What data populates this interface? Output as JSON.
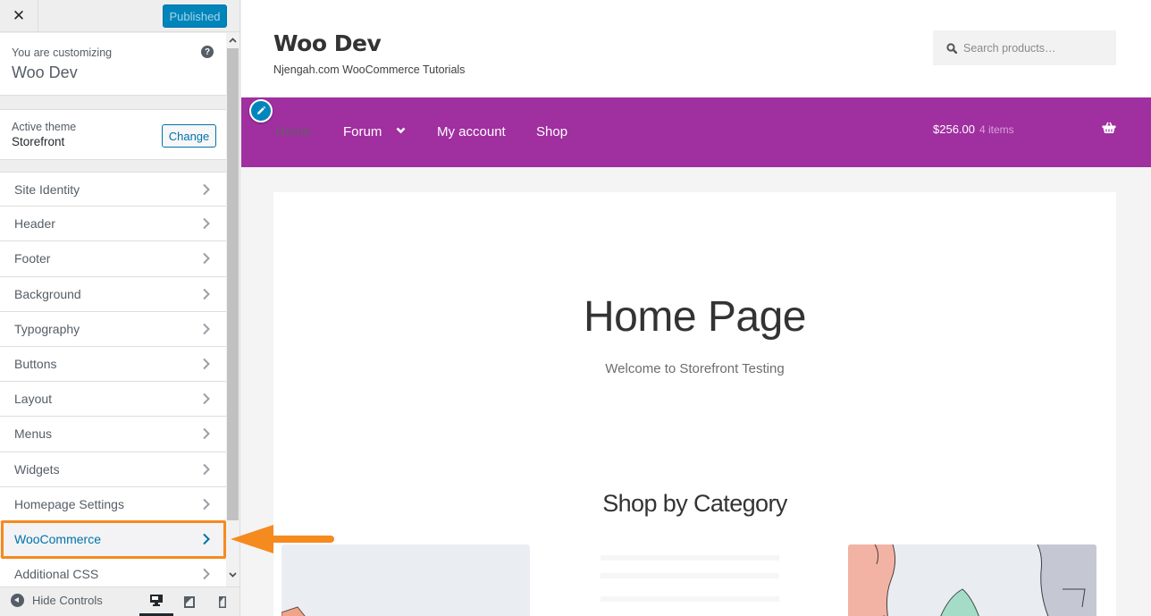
{
  "sidebar": {
    "close_label": "✕",
    "publish_button": "Published",
    "customizing_label": "You are customizing",
    "site_name": "Woo Dev",
    "help_icon": "?",
    "active_theme_label": "Active theme",
    "active_theme_name": "Storefront",
    "change_button": "Change",
    "sections": [
      {
        "label": "Site Identity"
      },
      {
        "label": "Header"
      },
      {
        "label": "Footer"
      },
      {
        "label": "Background"
      },
      {
        "label": "Typography"
      },
      {
        "label": "Buttons"
      },
      {
        "label": "Layout"
      },
      {
        "label": "Menus"
      },
      {
        "label": "Widgets"
      },
      {
        "label": "Homepage Settings"
      },
      {
        "label": "WooCommerce",
        "highlighted": true
      },
      {
        "label": "Additional CSS"
      }
    ],
    "footer": {
      "hide_controls": "Hide Controls",
      "devices": [
        "desktop",
        "tablet",
        "mobile"
      ],
      "active_device": "desktop"
    }
  },
  "preview": {
    "site_title": "Woo Dev",
    "tagline": "Njengah.com WooCommerce Tutorials",
    "search_placeholder": "Search products…",
    "nav": [
      {
        "label": "Home",
        "current": true
      },
      {
        "label": "Forum",
        "has_dropdown": true
      },
      {
        "label": "My account"
      },
      {
        "label": "Shop"
      }
    ],
    "cart": {
      "total": "$256.00",
      "count": "4 items"
    },
    "page_title": "Home Page",
    "page_subtitle": "Welcome to Storefront Testing",
    "shop_section_title": "Shop by Category"
  },
  "colors": {
    "accent_blue": "#0085ba",
    "nav_purple": "#a02fa0",
    "highlight_orange": "#f58a1f",
    "link_blue": "#0073aa"
  }
}
